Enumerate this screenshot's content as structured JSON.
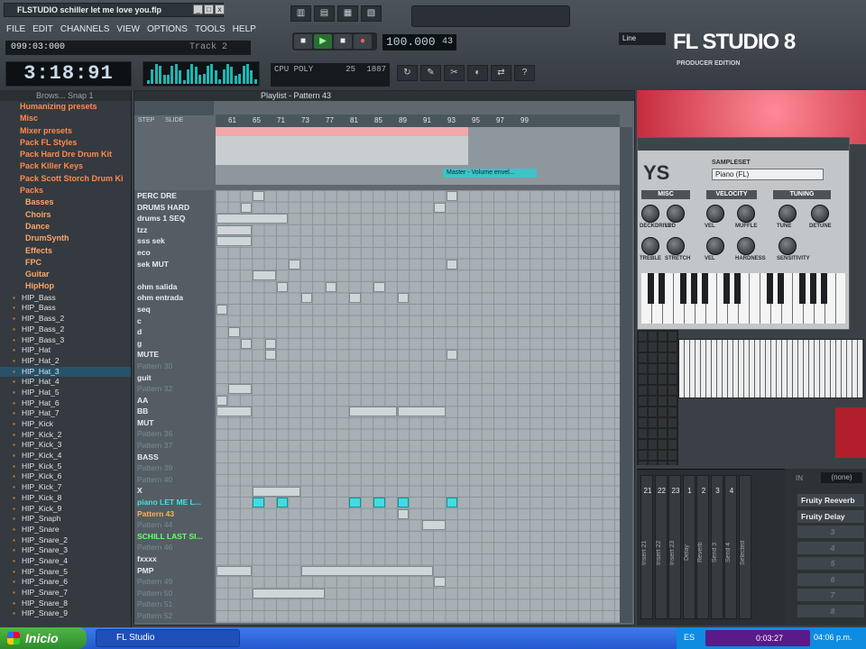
{
  "window": {
    "title": "FLSTUDIO schiller let me love you.flp",
    "min": "_",
    "max": "□",
    "close": "x"
  },
  "menu": [
    "FILE",
    "EDIT",
    "CHANNELS",
    "VIEW",
    "OPTIONS",
    "TOOLS",
    "HELP"
  ],
  "hint": {
    "position": "099:03:000",
    "track": "Track 2"
  },
  "time_display": "3:18:91",
  "transport": {
    "pat": "■",
    "play": "▶",
    "stop": "■",
    "rec": "●"
  },
  "tempo": {
    "value": "100.000",
    "pattern": "43"
  },
  "cpu": {
    "mem": "25",
    "time": "1887",
    "poly": "23",
    "label": "CPU POLY"
  },
  "snap": {
    "mode": "Line"
  },
  "logo": {
    "name": "FL STUDIO 8",
    "edition": "PRODUCER EDITION"
  },
  "top_icons": [
    "mixer",
    "piano",
    "plugin",
    "browser"
  ],
  "tool_icons": [
    "↻",
    "✎",
    "✂",
    "◐",
    "⇄",
    "?"
  ],
  "browser": {
    "title": "Brows... Snap 1",
    "items": [
      {
        "label": "Humanizing presets",
        "type": "folder"
      },
      {
        "label": "Misc",
        "type": "folder"
      },
      {
        "label": "Mixer presets",
        "type": "folder"
      },
      {
        "label": "Pack FL Styles",
        "type": "folder"
      },
      {
        "label": "Pack Hard Dre Drum Kit",
        "type": "folder"
      },
      {
        "label": "Pack Killer Keys",
        "type": "folder"
      },
      {
        "label": "Pack Scott Storch Drum Ki",
        "type": "folder"
      },
      {
        "label": "Packs",
        "type": "folder"
      },
      {
        "label": "Basses",
        "type": "sub"
      },
      {
        "label": "Choirs",
        "type": "sub"
      },
      {
        "label": "Dance",
        "type": "sub"
      },
      {
        "label": "DrumSynth",
        "type": "sub"
      },
      {
        "label": "Effects",
        "type": "sub"
      },
      {
        "label": "FPC",
        "type": "sub"
      },
      {
        "label": "Guitar",
        "type": "sub"
      },
      {
        "label": "HipHop",
        "type": "sub"
      }
    ],
    "files": [
      "HIP_Bass",
      "HIP_Bass",
      "HIP_Bass_2",
      "HIP_Bass_2",
      "HIP_Bass_3",
      "HIP_Hat",
      "HIP_Hat_2",
      "HIP_Hat_3",
      "HIP_Hat_4",
      "HIP_Hat_5",
      "HIP_Hat_6",
      "HIP_Hat_7",
      "HIP_Kick",
      "HIP_Kick_2",
      "HIP_Kick_3",
      "HIP_Kick_4",
      "HIP_Kick_5",
      "HIP_Kick_6",
      "HIP_Kick_7",
      "HIP_Kick_8",
      "HIP_Kick_9",
      "HIP_Snaph",
      "HIP_Snare",
      "HIP_Snare_2",
      "HIP_Snare_3",
      "HIP_Snare_4",
      "HIP_Snare_5",
      "HIP_Snare_6",
      "HIP_Snare_7",
      "HIP_Snare_8",
      "HIP_Snare_9"
    ],
    "selected_file": "HIP_Hat_3"
  },
  "playlist": {
    "title": "Playlist - Pattern 43",
    "step_label": "STEP",
    "slide_label": "SLIDE",
    "ruler": [
      "61",
      "65",
      "71",
      "73",
      "77",
      "81",
      "85",
      "89",
      "91",
      "93",
      "95",
      "97",
      "99"
    ],
    "envelope": "Master - Volume envel...",
    "channels": [
      {
        "name": "PERC DRE",
        "style": "normal"
      },
      {
        "name": "DRUMS HARD",
        "style": "normal"
      },
      {
        "name": "drums 1 SEQ",
        "style": "normal"
      },
      {
        "name": "tzz",
        "style": "normal"
      },
      {
        "name": "sss sek",
        "style": "normal"
      },
      {
        "name": "eco",
        "style": "normal"
      },
      {
        "name": "sek MUT",
        "style": "normal"
      },
      {
        "name": "",
        "style": "normal"
      },
      {
        "name": "ohm salida",
        "style": "normal"
      },
      {
        "name": "ohm entrada",
        "style": "normal"
      },
      {
        "name": "seq",
        "style": "normal"
      },
      {
        "name": "c",
        "style": "normal"
      },
      {
        "name": "d",
        "style": "normal"
      },
      {
        "name": "g",
        "style": "normal"
      },
      {
        "name": "MUTE",
        "style": "normal"
      },
      {
        "name": "Pattern 30",
        "style": "dim"
      },
      {
        "name": "guit",
        "style": "normal"
      },
      {
        "name": "Pattern 32",
        "style": "dim"
      },
      {
        "name": "AA",
        "style": "normal"
      },
      {
        "name": "BB",
        "style": "normal"
      },
      {
        "name": "MUT",
        "style": "normal"
      },
      {
        "name": "Pattern 36",
        "style": "dim"
      },
      {
        "name": "Pattern 37",
        "style": "dim"
      },
      {
        "name": "BASS",
        "style": "normal"
      },
      {
        "name": "Pattern 39",
        "style": "dim"
      },
      {
        "name": "Pattern 40",
        "style": "dim"
      },
      {
        "name": "X",
        "style": "normal"
      },
      {
        "name": "piano LET ME L...",
        "style": "cyan"
      },
      {
        "name": "Pattern 43",
        "style": "orange"
      },
      {
        "name": "Pattern 44",
        "style": "dim"
      },
      {
        "name": "SCHILL LAST SI...",
        "style": "green"
      },
      {
        "name": "Pattern 46",
        "style": "dim"
      },
      {
        "name": "fxxxx",
        "style": "normal"
      },
      {
        "name": "PMP",
        "style": "normal"
      },
      {
        "name": "Pattern 49",
        "style": "dim"
      },
      {
        "name": "Pattern 50",
        "style": "dim"
      },
      {
        "name": "Pattern 51",
        "style": "dim"
      },
      {
        "name": "Pattern 52",
        "style": "dim"
      }
    ]
  },
  "plugin": {
    "logo": "YS",
    "sampleset_label": "SAMPLESET",
    "sampleset_value": "Piano (FL)",
    "sections": [
      "MISC",
      "VELOCITY",
      "TUNING"
    ],
    "knob_labels": [
      "DECKDRIVE",
      "LPD",
      "VEL",
      "MUFFLE",
      "TUNE",
      "DETUNE",
      "TREBLE",
      "STRETCH",
      "VEL",
      "HARDNESS",
      "SENSITIVITY"
    ]
  },
  "mixer": {
    "channels": [
      {
        "num": "21",
        "name": "Insert 21"
      },
      {
        "num": "22",
        "name": "Insert 22"
      },
      {
        "num": "23",
        "name": "Insert 23"
      },
      {
        "num": "1",
        "name": "Delay"
      },
      {
        "num": "2",
        "name": "Reverb"
      },
      {
        "num": "3",
        "name": "Send 3"
      },
      {
        "num": "4",
        "name": "Send 4"
      },
      {
        "num": "",
        "name": "Selected"
      }
    ],
    "in_label": "IN",
    "in_value": "(none)",
    "fx_slots": [
      "Fruity Reeverb",
      "Fruity Delay",
      "3",
      "4",
      "5",
      "6",
      "7",
      "8"
    ]
  },
  "taskbar": {
    "start": "Inicio",
    "app": "FL Studio",
    "lang": "ES",
    "rec_time": "0:03:27",
    "clock": "04:06 p.m."
  }
}
